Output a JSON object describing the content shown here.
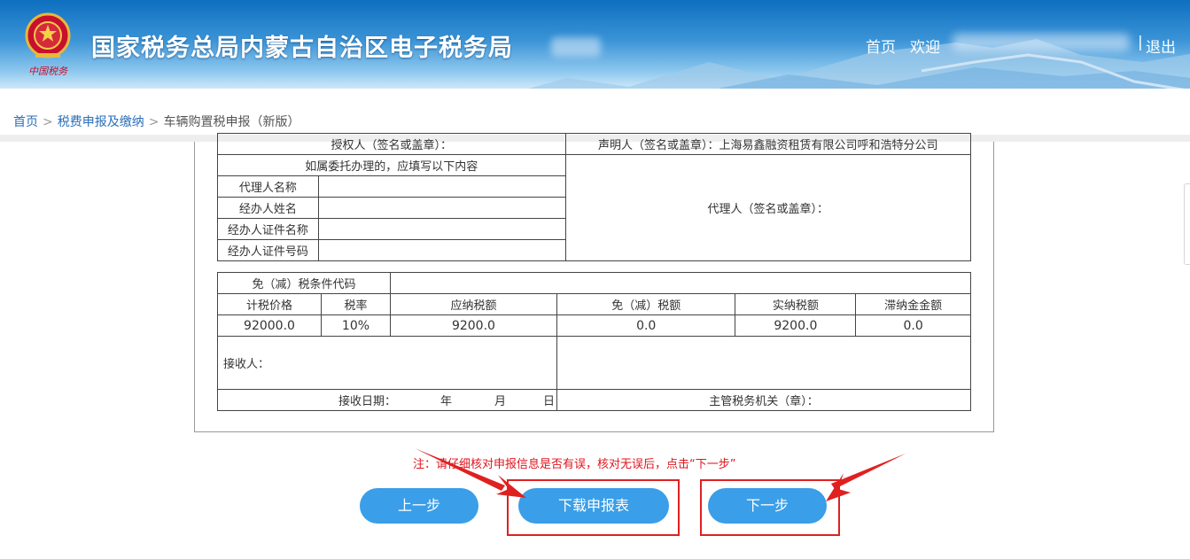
{
  "header": {
    "title": "国家税务总局内蒙古自治区电子税务局",
    "home": "首页",
    "welcome": "欢迎",
    "separator": "|",
    "logout": "退出",
    "emblem_caption": "中国税务"
  },
  "breadcrumb": {
    "items": [
      "首页",
      "税费申报及缴纳",
      "车辆购置税申报（新版）"
    ],
    "separator": ">"
  },
  "form": {
    "authorizer_label": "授权人（签名或盖章）：",
    "declarer_label": "声明人（签名或盖章）：上海易鑫融资租赁有限公司呼和浩特分公司",
    "entrust_note": "如属委托办理的，应填写以下内容",
    "agent_name": "代理人名称",
    "handler_name": "经办人姓名",
    "handler_id_type": "经办人证件名称",
    "handler_id_no": "经办人证件号码",
    "agent_sign": "代理人（签名或盖章）：",
    "exemption_code": "免（减）税条件代码",
    "headers": [
      "计税价格",
      "税率",
      "应纳税额",
      "免（减）税额",
      "实纳税额",
      "滞纳金金额"
    ],
    "values": [
      "92000.0",
      "10%",
      "9200.0",
      "0.0",
      "9200.0",
      "0.0"
    ],
    "receiver": "接收人：",
    "receive_date": "接收日期：",
    "year": "年",
    "month": "月",
    "day": "日",
    "tax_authority": "主管税务机关（章）："
  },
  "note": "注：请仔细核对申报信息是否有误，核对无误后，点击“下一步”",
  "buttons": {
    "prev": "上一步",
    "download": "下载申报表",
    "next": "下一步"
  },
  "colors": {
    "header_blue": "#1a78c8",
    "button_blue": "#3a9ee8",
    "note_red": "#e0141e",
    "highlight_red": "#e02020",
    "link_blue": "#2a6fb8"
  }
}
